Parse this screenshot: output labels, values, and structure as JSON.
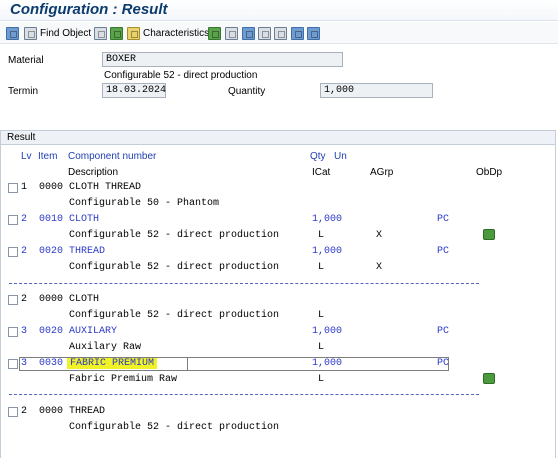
{
  "window": {
    "title": "Configuration : Result"
  },
  "toolbar": {
    "find_object_label": "Find Object",
    "characteristics_label": "Characteristics"
  },
  "header": {
    "material_label": "Material",
    "material_value": "BOXER",
    "material_desc": "Configurable 52 - direct production",
    "termin_label": "Termin",
    "termin_value": "18.03.2024",
    "quantity_label": "Quantity",
    "quantity_value": "1,000"
  },
  "result": {
    "section_label": "Result",
    "columns": {
      "lv": "Lv",
      "item": "Item",
      "component": "Component number",
      "description": "Description",
      "qty": "Qty",
      "un": "Un",
      "icat": "ICat",
      "agrp": "AGrp",
      "obdp": "ObDp"
    },
    "rows": [
      {
        "lv": "1",
        "item": "0000",
        "component": "CLOTH THREAD",
        "description": "Configurable 50 - Phantom",
        "qty": "",
        "un": "",
        "icat": "",
        "agrp": "",
        "blue": false,
        "obdp": false
      },
      {
        "lv": "2",
        "item": "0010",
        "component": "CLOTH",
        "description": "Configurable 52 - direct production",
        "qty": "1,000",
        "un": "PC",
        "icat": "L",
        "agrp": "X",
        "blue": true,
        "obdp": true
      },
      {
        "lv": "2",
        "item": "0020",
        "component": "THREAD",
        "description": "Configurable 52 - direct production",
        "qty": "1,000",
        "un": "PC",
        "icat": "L",
        "agrp": "X",
        "blue": true,
        "obdp": false
      },
      {
        "lv": "2",
        "item": "0000",
        "component": "CLOTH",
        "description": "Configurable 52 - direct production",
        "qty": "",
        "un": "",
        "icat": "L",
        "agrp": "",
        "blue": false,
        "obdp": false
      },
      {
        "lv": "3",
        "item": "0020",
        "component": "AUXILARY",
        "description": "Auxilary Raw",
        "qty": "1,000",
        "un": "PC",
        "icat": "L",
        "agrp": "",
        "blue": true,
        "obdp": false
      },
      {
        "lv": "3",
        "item": "0030",
        "component": "FABRIC PREMIUM",
        "description": "Fabric Premium Raw",
        "qty": "1,000",
        "un": "PC",
        "icat": "L",
        "agrp": "",
        "blue": true,
        "obdp": true,
        "highlight": true
      },
      {
        "lv": "2",
        "item": "0000",
        "component": "THREAD",
        "description": "Configurable 52 - direct production",
        "qty": "",
        "un": "",
        "icat": "L",
        "agrp": "",
        "blue": false,
        "obdp": false
      }
    ]
  }
}
